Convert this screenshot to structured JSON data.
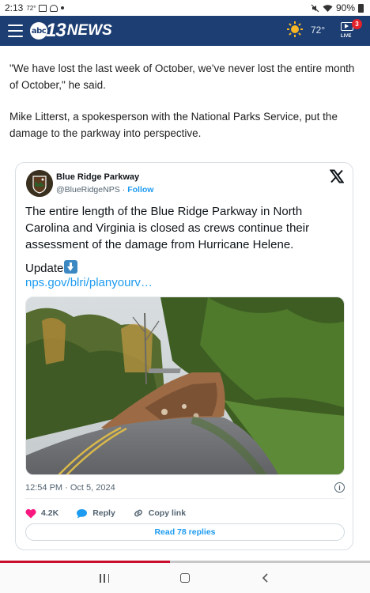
{
  "status_bar": {
    "time": "2:13",
    "temp_small": "72°",
    "battery": "90%"
  },
  "header": {
    "logo_abc": "abc",
    "logo_number": "13",
    "logo_news": "NEWS",
    "temperature": "72°",
    "live_label": "LIVE",
    "live_badge": "3",
    "icons": [
      "menu-icon",
      "sun-icon",
      "live-tv-icon"
    ],
    "brand_color": "#1d3e72"
  },
  "article": {
    "paragraphs": [
      "\"We have lost the last week of October, we've never lost the entire month of October,\" he said.",
      "Mike Litterst, a spokesperson with the National Parks Service, put the damage to the parkway into perspective."
    ]
  },
  "tweet": {
    "author_name": "Blue Ridge Parkway",
    "handle": "@BlueRidgeNPS",
    "separator": "·",
    "follow_label": "Follow",
    "text": "The entire length of the Blue Ridge Parkway in North Carolina and Virginia is closed as crews continue their assessment of the damage from Hurricane Helene.",
    "update_label": "Update",
    "link": "nps.gov/blri/planyourv…",
    "timestamp": "12:54 PM · Oct 5, 2024",
    "likes": "4.2K",
    "reply_label": "Reply",
    "copy_link_label": "Copy link",
    "read_replies_label": "Read 78 replies",
    "accent_color": "#1d9bf0",
    "icons": [
      "x-logo-icon",
      "arrow-down-emoji-icon",
      "info-icon",
      "heart-icon",
      "reply-bubble-icon",
      "link-icon"
    ]
  },
  "reading_progress": 0.46,
  "nav_bar": {
    "icons": [
      "recent-apps-icon",
      "home-icon",
      "back-icon"
    ]
  }
}
